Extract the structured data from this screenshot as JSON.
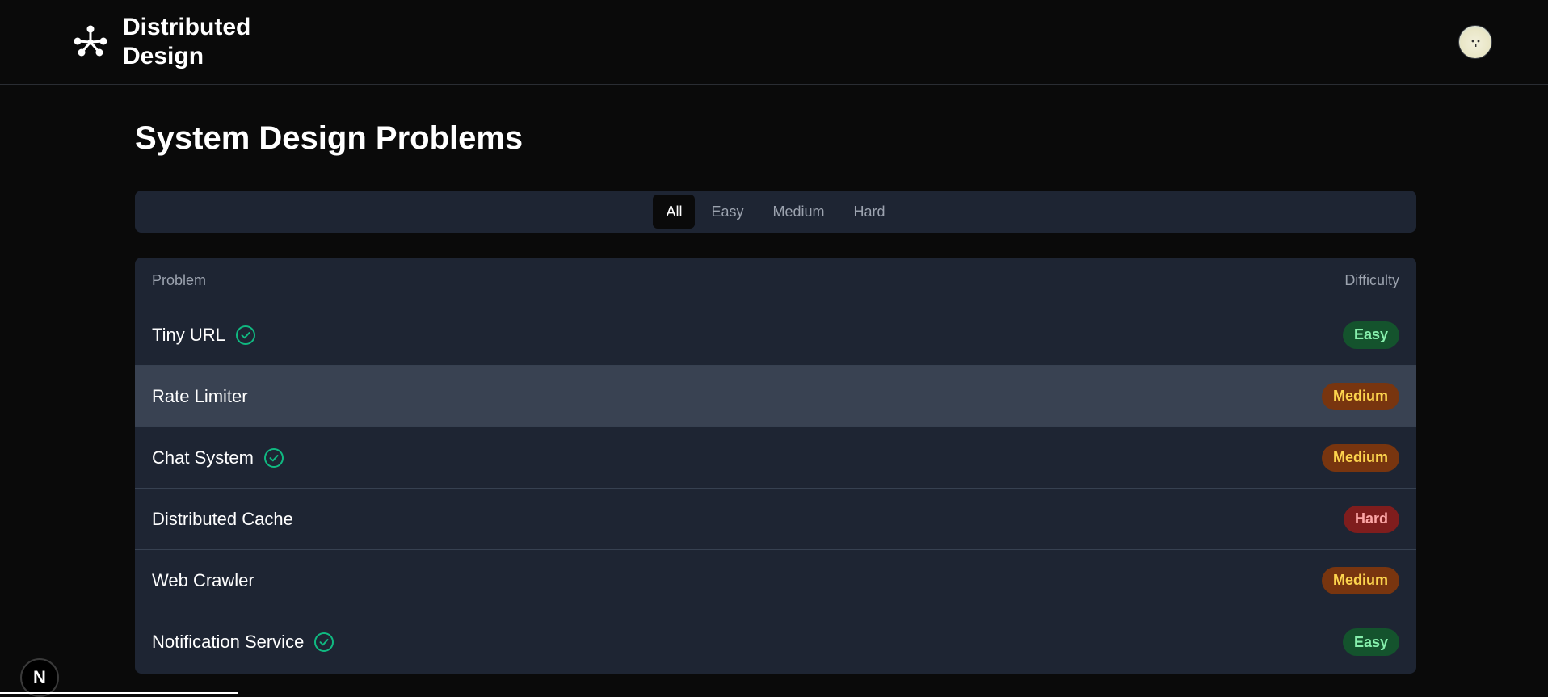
{
  "brand": {
    "name_line1": "Distributed",
    "name_line2": "Design"
  },
  "page": {
    "title": "System Design Problems"
  },
  "filters": [
    "All",
    "Easy",
    "Medium",
    "Hard"
  ],
  "active_filter": "All",
  "table": {
    "headers": {
      "problem": "Problem",
      "difficulty": "Difficulty"
    },
    "rows": [
      {
        "name": "Tiny URL",
        "completed": true,
        "difficulty": "Easy"
      },
      {
        "name": "Rate Limiter",
        "completed": false,
        "difficulty": "Medium"
      },
      {
        "name": "Chat System",
        "completed": true,
        "difficulty": "Medium"
      },
      {
        "name": "Distributed Cache",
        "completed": false,
        "difficulty": "Hard"
      },
      {
        "name": "Web Crawler",
        "completed": false,
        "difficulty": "Medium"
      },
      {
        "name": "Notification Service",
        "completed": true,
        "difficulty": "Easy"
      }
    ]
  },
  "dev_indicator": {
    "label": "N"
  },
  "colors": {
    "background": "#0a0a0a",
    "panel": "#1e2533",
    "row_hover": "#394252",
    "check": "#10b981",
    "easy_bg": "#14532d",
    "easy_text": "#86efac",
    "medium_bg": "#78350f",
    "medium_text": "#fcd34d",
    "hard_bg": "#7f1d1d",
    "hard_text": "#fca5a5"
  },
  "icons": {
    "logo": "network-nodes-icon",
    "completed": "check-circle-icon",
    "avatar": "user-avatar"
  }
}
